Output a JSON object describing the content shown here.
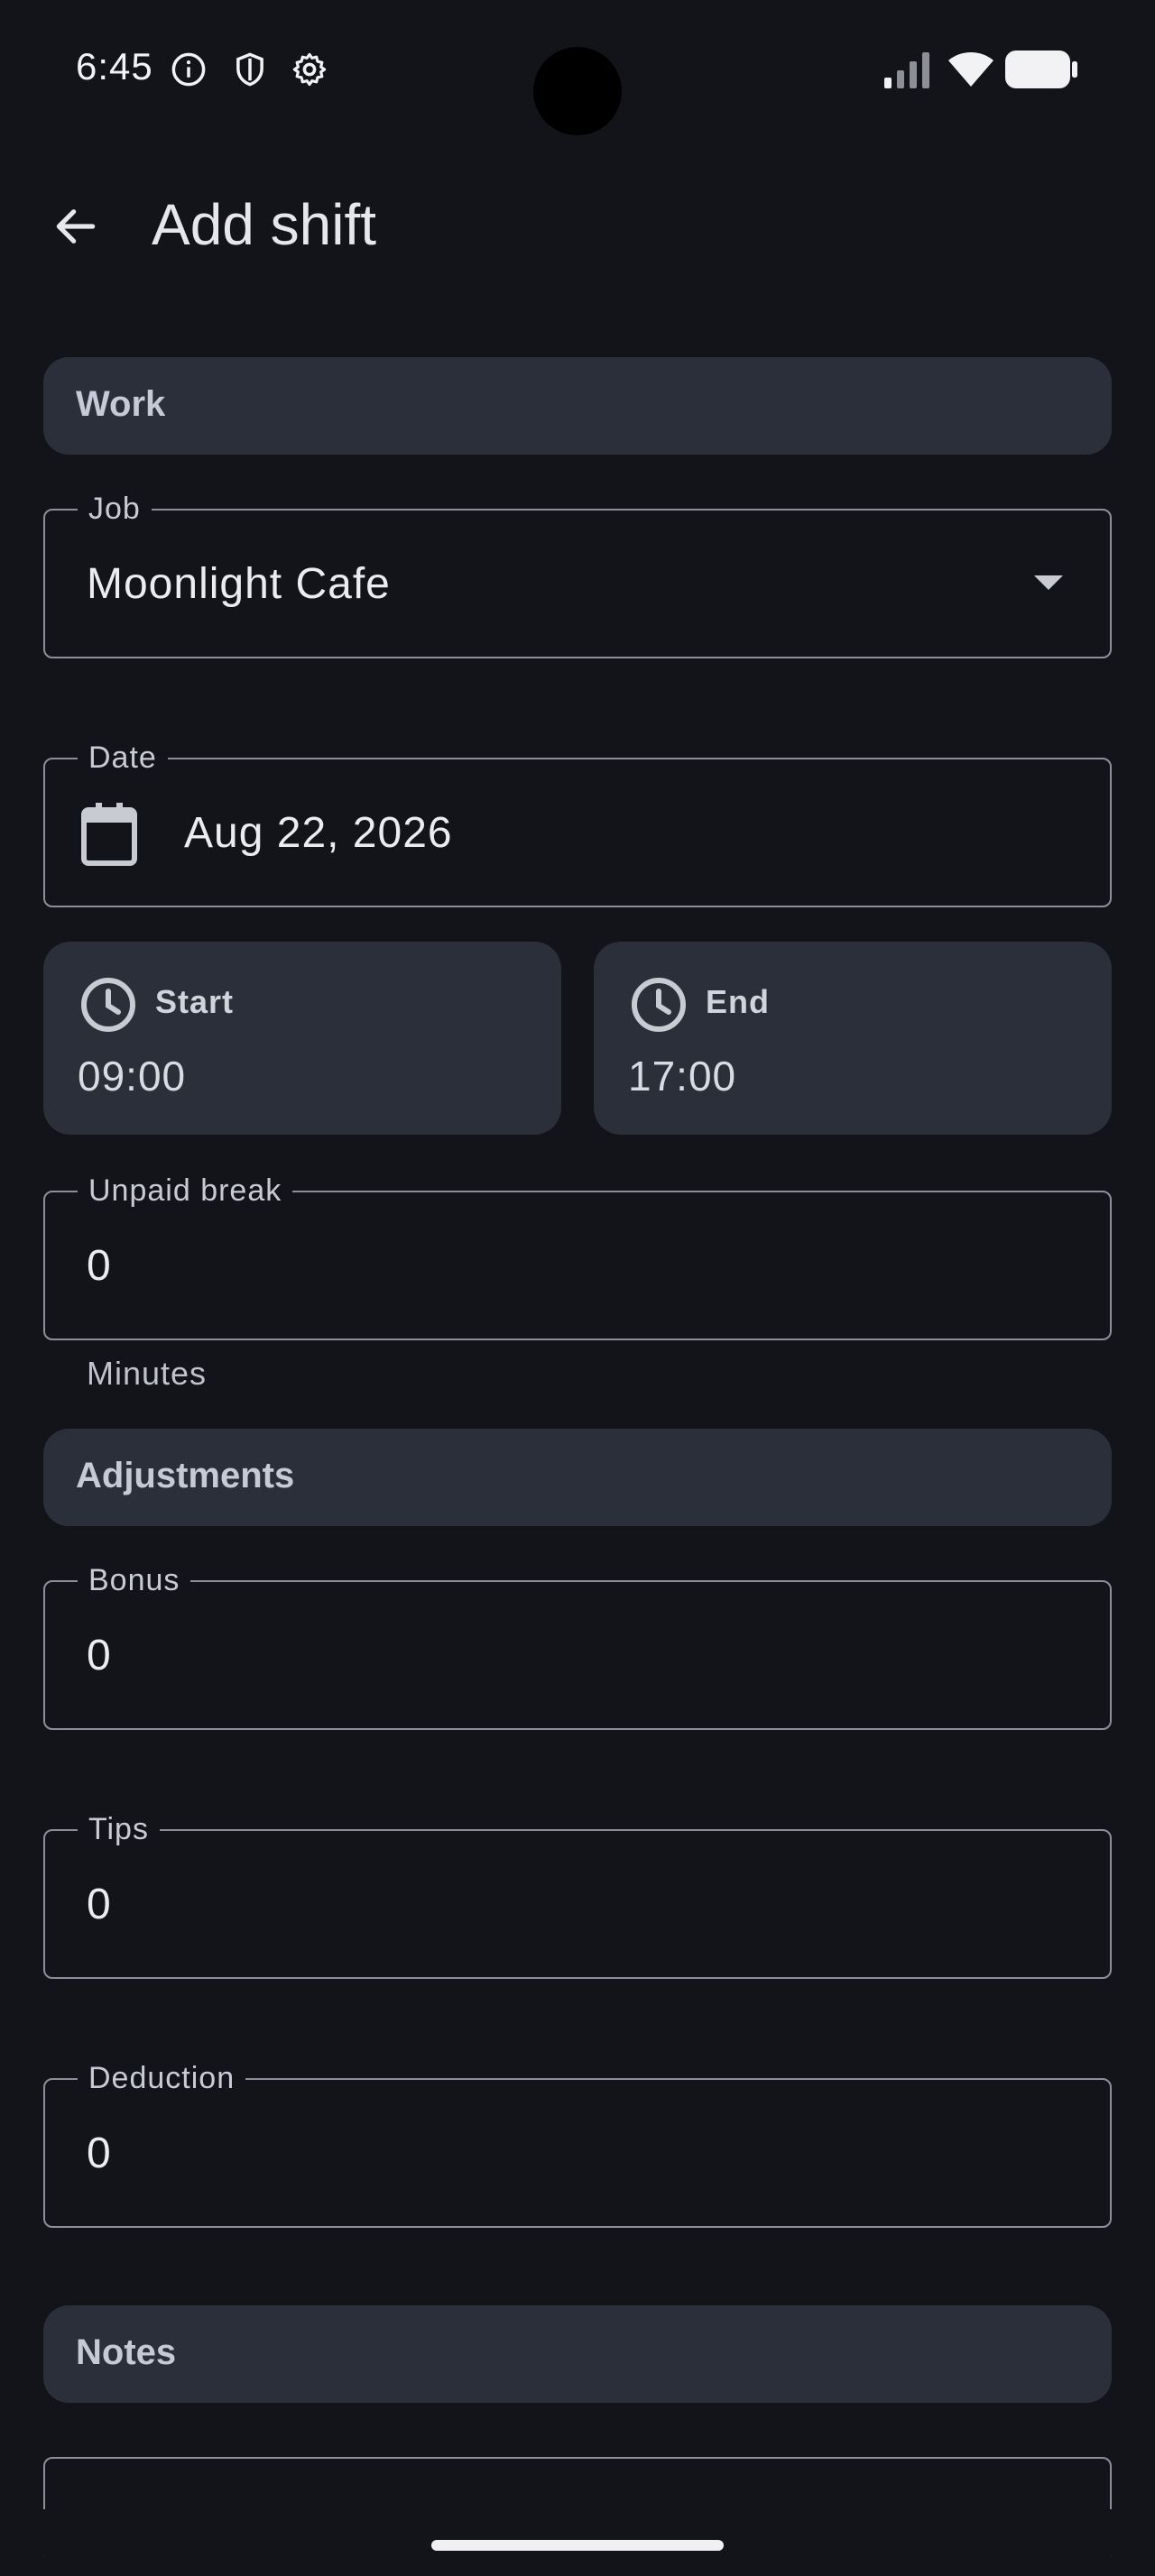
{
  "status_bar": {
    "time": "6:45"
  },
  "app_bar": {
    "title": "Add shift"
  },
  "sections": {
    "work": "Work",
    "adjustments": "Adjustments",
    "notes": "Notes"
  },
  "fields": {
    "job": {
      "label": "Job",
      "value": "Moonlight Cafe"
    },
    "date": {
      "label": "Date",
      "value": "Aug 22, 2026"
    },
    "unpaid_break": {
      "label": "Unpaid break",
      "value": "0",
      "helper": "Minutes"
    },
    "bonus": {
      "label": "Bonus",
      "value": "0"
    },
    "tips": {
      "label": "Tips",
      "value": "0"
    },
    "deduction": {
      "label": "Deduction",
      "value": "0"
    }
  },
  "time_cards": {
    "start": {
      "label": "Start",
      "value": "09:00"
    },
    "end": {
      "label": "End",
      "value": "17:00"
    }
  },
  "icons": {
    "back": "arrow-back-icon",
    "calendar": "calendar-icon",
    "clock": "clock-icon",
    "dropdown": "caret-down-icon"
  },
  "colors": {
    "background": "#131419",
    "surface": "#2b2f3a",
    "outline": "#8c8f99",
    "text": "#e3e3e8"
  }
}
